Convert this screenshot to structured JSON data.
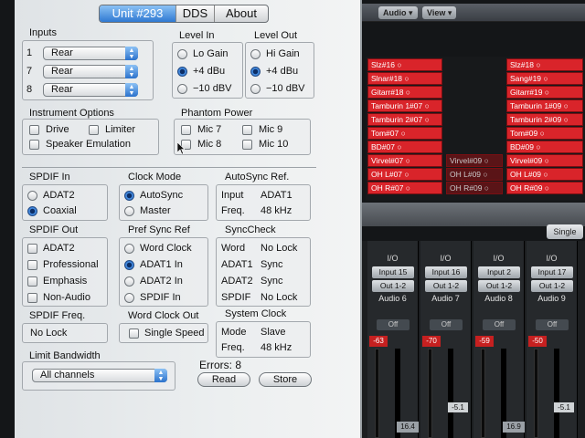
{
  "tabs": [
    {
      "label": "Unit #293",
      "active": true
    },
    {
      "label": "DDS",
      "active": false
    },
    {
      "label": "About",
      "active": false
    }
  ],
  "inputs": {
    "title": "Inputs",
    "rows": [
      {
        "channel": "1",
        "value": "Rear"
      },
      {
        "channel": "7",
        "value": "Rear"
      },
      {
        "channel": "8",
        "value": "Rear"
      }
    ]
  },
  "level_in": {
    "title": "Level In",
    "options": [
      "Lo Gain",
      "+4 dBu",
      "−10 dBV"
    ],
    "selected": "+4 dBu"
  },
  "level_out": {
    "title": "Level Out",
    "options": [
      "Hi Gain",
      "+4 dBu",
      "−10 dBV"
    ],
    "selected": "+4 dBu"
  },
  "instrument_options": {
    "title": "Instrument Options",
    "drive": "Drive",
    "limiter": "Limiter",
    "speaker_emulation": "Speaker Emulation"
  },
  "phantom_power": {
    "title": "Phantom Power",
    "mic7": "Mic 7",
    "mic8": "Mic 8",
    "mic9": "Mic 9",
    "mic10": "Mic 10"
  },
  "spdif_in": {
    "title": "SPDIF In",
    "options": [
      "ADAT2",
      "Coaxial"
    ],
    "selected": "Coaxial"
  },
  "clock_mode": {
    "title": "Clock Mode",
    "options": [
      "AutoSync",
      "Master"
    ],
    "selected": "AutoSync"
  },
  "autosync_ref": {
    "title": "AutoSync Ref.",
    "input_label": "Input",
    "input_value": "ADAT1",
    "freq_label": "Freq.",
    "freq_value": "48 kHz"
  },
  "spdif_out": {
    "title": "SPDIF Out",
    "adat2": "ADAT2",
    "professional": "Professional",
    "emphasis": "Emphasis",
    "non_audio": "Non-Audio"
  },
  "pref_sync_ref": {
    "title": "Pref Sync Ref",
    "options": [
      "Word Clock",
      "ADAT1 In",
      "ADAT2 In",
      "SPDIF In"
    ],
    "selected": "ADAT1 In"
  },
  "synccheck": {
    "title": "SyncCheck",
    "rows": [
      {
        "label": "Word",
        "value": "No Lock"
      },
      {
        "label": "ADAT1",
        "value": "Sync"
      },
      {
        "label": "ADAT2",
        "value": "Sync"
      },
      {
        "label": "SPDIF",
        "value": "No Lock"
      }
    ]
  },
  "spdif_freq": {
    "title": "SPDIF Freq.",
    "value": "No Lock"
  },
  "word_clock_out": {
    "title": "Word Clock Out",
    "single_speed": "Single Speed"
  },
  "system_clock": {
    "title": "System Clock",
    "mode_label": "Mode",
    "mode_value": "Slave",
    "freq_label": "Freq.",
    "freq_value": "48 kHz"
  },
  "limit_bandwidth": {
    "title": "Limit Bandwidth",
    "value": "All channels"
  },
  "errors": {
    "text": "Errors: 8"
  },
  "buttons": {
    "read": "Read",
    "store": "Store"
  },
  "daw": {
    "menus": [
      "Audio ▾",
      "View ▾"
    ],
    "regions_col1": [
      "Slz#16 ○",
      "Slnar#18 ○",
      "Gitarr#18 ○",
      "Tamburin 1#07 ○",
      "Tamburin 2#07 ○",
      "Tom#07 ○",
      "BD#07 ○",
      "Virvel#07 ○",
      "OH L#07 ○",
      "OH R#07 ○"
    ],
    "regions_col2": [
      "Virvel#09 ○",
      "OH L#09 ○",
      "OH R#09 ○"
    ],
    "regions_col3": [
      "Slz#18 ○",
      "Sang#19 ○",
      "Gitarr#19 ○",
      "Tamburin 1#09 ○",
      "Tamburin 2#09 ○",
      "Tom#09 ○",
      "BD#09 ○",
      "Virvel#09 ○",
      "OH L#09 ○",
      "OH R#09 ○"
    ],
    "single": "Single",
    "strips": [
      {
        "io": "I/O",
        "input": "Input 15",
        "out": "Out 1-2",
        "name": "Audio 6",
        "off": "Off",
        "peak": "-63",
        "value": "16.4"
      },
      {
        "io": "I/O",
        "input": "Input 16",
        "out": "Out 1-2",
        "name": "Audio 7",
        "off": "Off",
        "peak": "-70",
        "value": "-5.1"
      },
      {
        "io": "I/O",
        "input": "Input 2",
        "out": "Out 1-2",
        "name": "Audio 8",
        "off": "Off",
        "peak": "-59",
        "value": "16.9"
      },
      {
        "io": "I/O",
        "input": "Input 17",
        "out": "Out 1-2",
        "name": "Audio 9",
        "off": "Off",
        "peak": "-50",
        "value": "-5.1"
      }
    ]
  }
}
